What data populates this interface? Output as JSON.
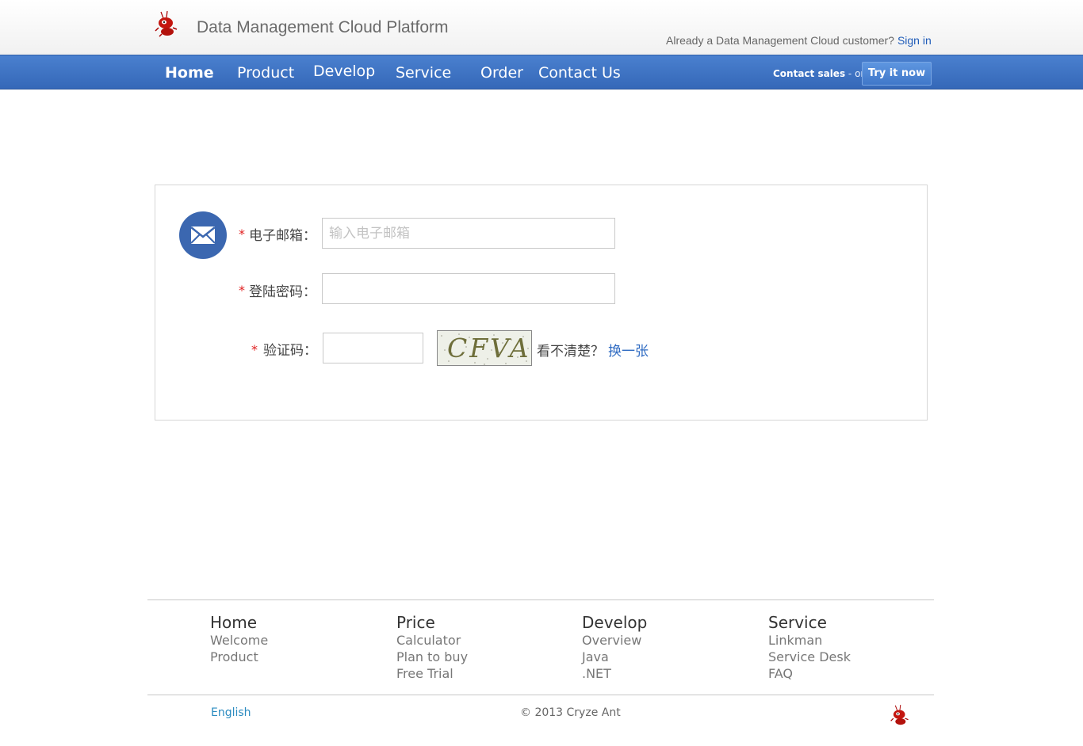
{
  "header": {
    "site_title": "Data Management Cloud Platform",
    "customer_prompt": "Already a Data Management Cloud customer?",
    "sign_in_label": "Sign in"
  },
  "nav": {
    "items": [
      {
        "label": "Home"
      },
      {
        "label": "Product"
      },
      {
        "label": "Develop"
      },
      {
        "label": "Service"
      },
      {
        "label": "Order"
      },
      {
        "label": "Contact Us"
      }
    ],
    "contact_sales_label": "Contact sales",
    "or_label": "- or -",
    "try_label": "Try it now"
  },
  "form": {
    "required_mark": "*",
    "email_label": "电子邮箱：",
    "email_placeholder": "输入电子邮箱",
    "email_value": "",
    "password_label": "登陆密码：",
    "password_value": "",
    "captcha_label": "验证码：",
    "captcha_value": "",
    "captcha_image_text": "CFVA",
    "unclear_text": "看不清楚？",
    "refresh_link": "换一张"
  },
  "footer": {
    "columns": [
      {
        "title": "Home",
        "links": [
          "Welcome",
          "Product"
        ]
      },
      {
        "title": "Price",
        "links": [
          "Calculator",
          "Plan to buy",
          "Free Trial"
        ]
      },
      {
        "title": "Develop",
        "links": [
          "Overview",
          "Java",
          ".NET"
        ]
      },
      {
        "title": "Service",
        "links": [
          "Linkman",
          "Service Desk",
          "FAQ"
        ]
      }
    ],
    "language_link": "English",
    "copyright": "© 2013 Cryze Ant"
  },
  "colors": {
    "nav_blue": "#3a6dbd",
    "link_blue": "#1e5bb8",
    "required_red": "#e02020",
    "mail_circle": "#3b67b0"
  },
  "icons": [
    "ant-logo-icon",
    "mail-icon"
  ]
}
